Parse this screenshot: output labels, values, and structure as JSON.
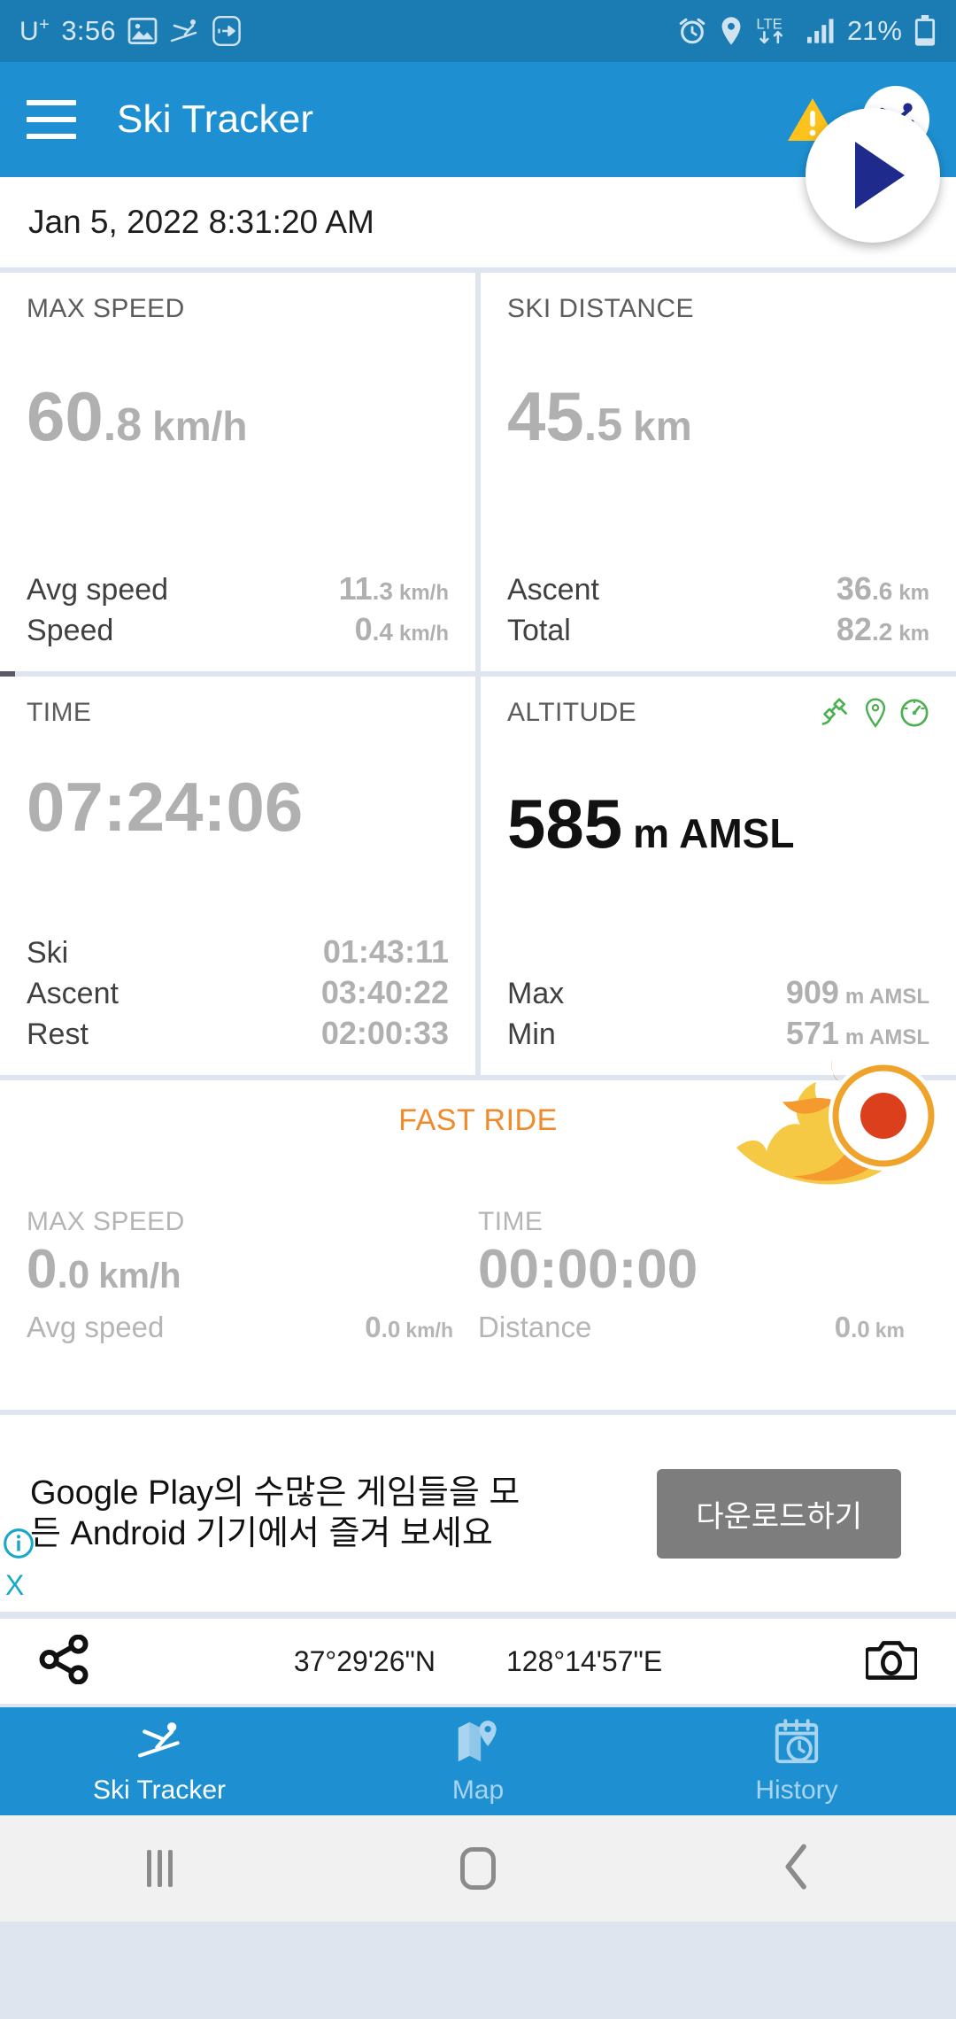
{
  "status_bar": {
    "carrier": "U",
    "carrier_sup": "+",
    "time": "3:56",
    "battery_percent": "21%",
    "left_icons": [
      "gallery-icon",
      "skier-icon",
      "data-saver-icon"
    ],
    "right_icons": [
      "alarm-icon",
      "location-icon",
      "lte-icon",
      "signal-icon",
      "battery-icon"
    ],
    "network": "LTE",
    "bg_color": "#1b7cb3"
  },
  "app_bar": {
    "title": "Ski Tracker",
    "menu_icon": "hamburger-icon",
    "warning_icon": "warning-triangle-icon",
    "ski_icon": "ski-badge-icon",
    "start_icon": "play-icon",
    "bg_color": "#1e90d2",
    "accent_color": "#1f2b8c"
  },
  "session": {
    "datetime": "Jan 5, 2022 8:31:20 AM"
  },
  "cards": [
    {
      "title": "MAX SPEED",
      "value_int": "60",
      "value_dec": ".8",
      "value_unit": "km/h",
      "dark": false,
      "rows": [
        {
          "label": "Avg speed",
          "int": "11",
          "dec": ".3",
          "unit": "km/h"
        },
        {
          "label": "Speed",
          "int": "0",
          "dec": ".4",
          "unit": "km/h"
        }
      ]
    },
    {
      "title": "SKI DISTANCE",
      "value_int": "45",
      "value_dec": ".5",
      "value_unit": "km",
      "dark": false,
      "rows": [
        {
          "label": "Ascent",
          "int": "36",
          "dec": ".6",
          "unit": "km"
        },
        {
          "label": "Total",
          "int": "82",
          "dec": ".2",
          "unit": "km"
        }
      ]
    },
    {
      "title": "TIME",
      "value_time": "07:24:06",
      "dark": false,
      "rows": [
        {
          "label": "Ski",
          "time": "01:43:11"
        },
        {
          "label": "Ascent",
          "time": "03:40:22"
        },
        {
          "label": "Rest",
          "time": "02:00:33"
        }
      ]
    },
    {
      "title": "ALTITUDE",
      "value_int": "585",
      "value_dec": "",
      "value_unit": "m AMSL",
      "dark": true,
      "icons": [
        "satellite-icon",
        "location-pin-icon",
        "barometer-icon"
      ],
      "icon_color": "#4caf50",
      "rows": [
        {
          "label": "Max",
          "int": "909",
          "dec": "",
          "unit": "m AMSL"
        },
        {
          "label": "Min",
          "int": "571",
          "dec": "",
          "unit": "m AMSL"
        }
      ]
    }
  ],
  "fast_ride": {
    "title": "FAST RIDE",
    "title_color": "#f08a2a",
    "record_icon": "flame-record-icon",
    "columns": [
      {
        "label": "MAX SPEED",
        "int": "0",
        "dec": ".0",
        "unit": "km/h",
        "sub_label": "Avg speed",
        "sub_int": "0",
        "sub_dec": ".0",
        "sub_unit": "km/h"
      },
      {
        "label": "TIME",
        "time": "00:00:00",
        "sub_label": "Distance",
        "sub_int": "0",
        "sub_dec": ".0",
        "sub_unit": "km"
      }
    ]
  },
  "ad": {
    "text": "Google Play의 수많은 게임들을 모든 Android 기기에서 즐겨 보세요",
    "button_label": "다운로드하기",
    "info_icon": "ad-info-icon",
    "close_icon": "ad-close-icon",
    "close_label": "X"
  },
  "coords": {
    "share_icon": "share-icon",
    "latitude": "37°29'26\"N",
    "longitude": "128°14'57\"E",
    "camera_icon": "camera-icon"
  },
  "bottom_nav": {
    "items": [
      {
        "label": "Ski Tracker",
        "icon": "skier-icon",
        "active": true
      },
      {
        "label": "Map",
        "icon": "map-pin-icon",
        "active": false
      },
      {
        "label": "History",
        "icon": "calendar-clock-icon",
        "active": false
      }
    ]
  },
  "android_nav": {
    "recents_icon": "recents-icon",
    "home_icon": "home-icon",
    "back_icon": "back-icon"
  }
}
